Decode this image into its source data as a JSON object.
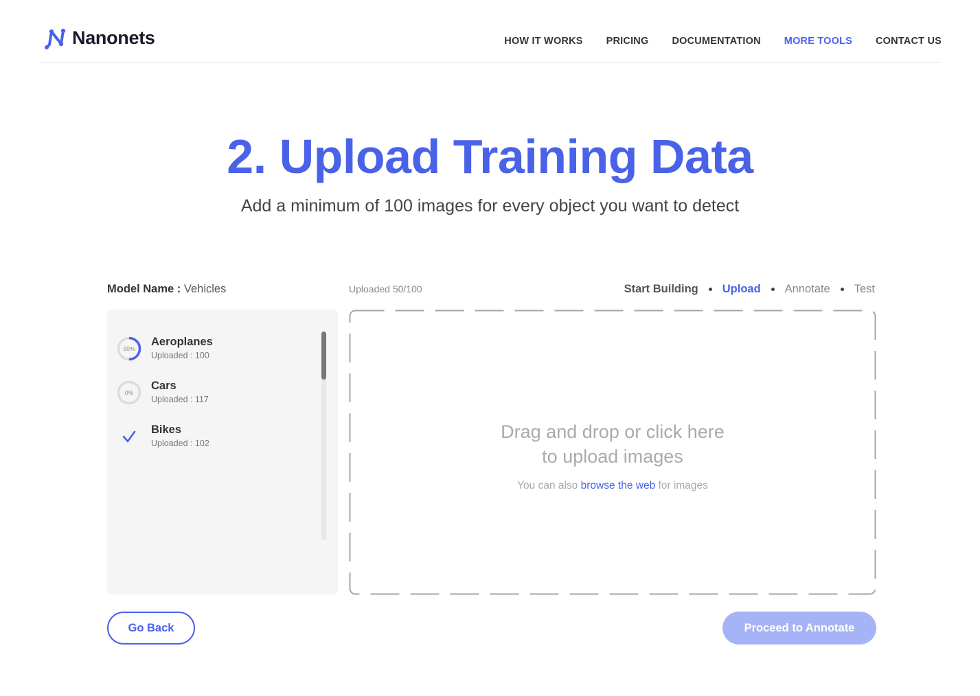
{
  "header": {
    "logo_text": "Nanonets",
    "nav": [
      {
        "label": "HOW IT WORKS"
      },
      {
        "label": "PRICING"
      },
      {
        "label": "DOCUMENTATION"
      },
      {
        "label": "MORE TOOLS",
        "active": true
      },
      {
        "label": "CONTACT US"
      }
    ]
  },
  "hero": {
    "title": "2. Upload Training Data",
    "subtitle": "Add a minimum of 100 images for every object you want to detect"
  },
  "model": {
    "label": "Model Name :",
    "value": "Vehicles"
  },
  "upload_status": "Uploaded 50/100",
  "steps": [
    {
      "label": "Start Building",
      "state": "done"
    },
    {
      "label": "Upload",
      "state": "current"
    },
    {
      "label": "Annotate",
      "state": "pending"
    },
    {
      "label": "Test",
      "state": "pending"
    }
  ],
  "classes": [
    {
      "name": "Aeroplanes",
      "uploaded": "Uploaded : 100",
      "progress_label": "50%",
      "progress": 0.5,
      "status": "in-progress"
    },
    {
      "name": "Cars",
      "uploaded": "Uploaded : 117",
      "progress_label": "0%",
      "progress": 0,
      "status": "in-progress"
    },
    {
      "name": "Bikes",
      "uploaded": "Uploaded : 102",
      "progress_label": "",
      "progress": 1,
      "status": "complete"
    }
  ],
  "dropzone": {
    "line1": "Drag and drop or click here",
    "line2": "to upload images",
    "sub_prefix": "You can also",
    "sub_link": "browse the web",
    "sub_suffix": "for images"
  },
  "buttons": {
    "back": "Go Back",
    "next": "Proceed to Annotate"
  },
  "colors": {
    "accent": "#4a62e8",
    "accent_disabled": "#a7b3f7",
    "panel_bg": "#f5f5f5"
  }
}
